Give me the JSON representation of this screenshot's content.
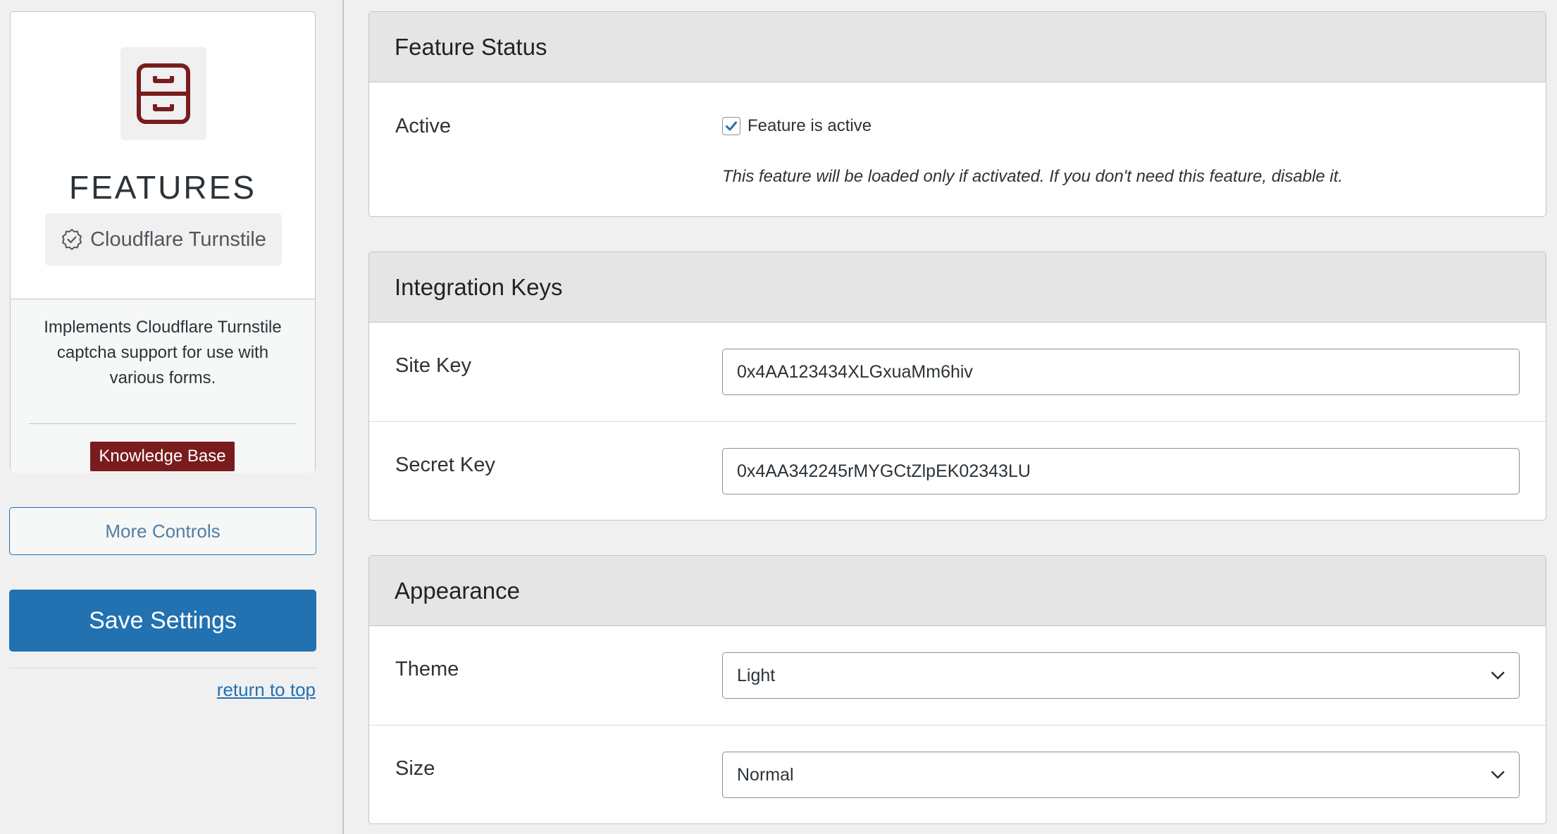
{
  "sidebar": {
    "card_title": "FEATURES",
    "feature_name": "Cloudflare Turnstile",
    "description": "Implements Cloudflare Turnstile captcha support for use with various forms.",
    "knowledge_base_label": "Knowledge Base",
    "more_controls_label": "More Controls",
    "save_settings_label": "Save Settings",
    "return_to_top_label": "return to top",
    "icons": {
      "feature": "file-cabinet-icon",
      "badge": "check-badge-icon"
    }
  },
  "feature_status": {
    "title": "Feature Status",
    "active_label": "Active",
    "checkbox_label": "Feature is active",
    "checked": true,
    "help_text": "This feature will be loaded only if activated. If you don't need this feature, disable it."
  },
  "integration_keys": {
    "title": "Integration Keys",
    "site_key_label": "Site Key",
    "site_key_value": "0x4AA123434XLGxuaMm6hiv",
    "secret_key_label": "Secret Key",
    "secret_key_value": "0x4AA342245rMYGCtZlpEK02343LU"
  },
  "appearance": {
    "title": "Appearance",
    "theme_label": "Theme",
    "theme_value": "Light",
    "size_label": "Size",
    "size_value": "Normal"
  },
  "colors": {
    "brand_red": "#7a1c1c",
    "primary_blue": "#2271b1",
    "header_gray": "#e5e5e5"
  }
}
